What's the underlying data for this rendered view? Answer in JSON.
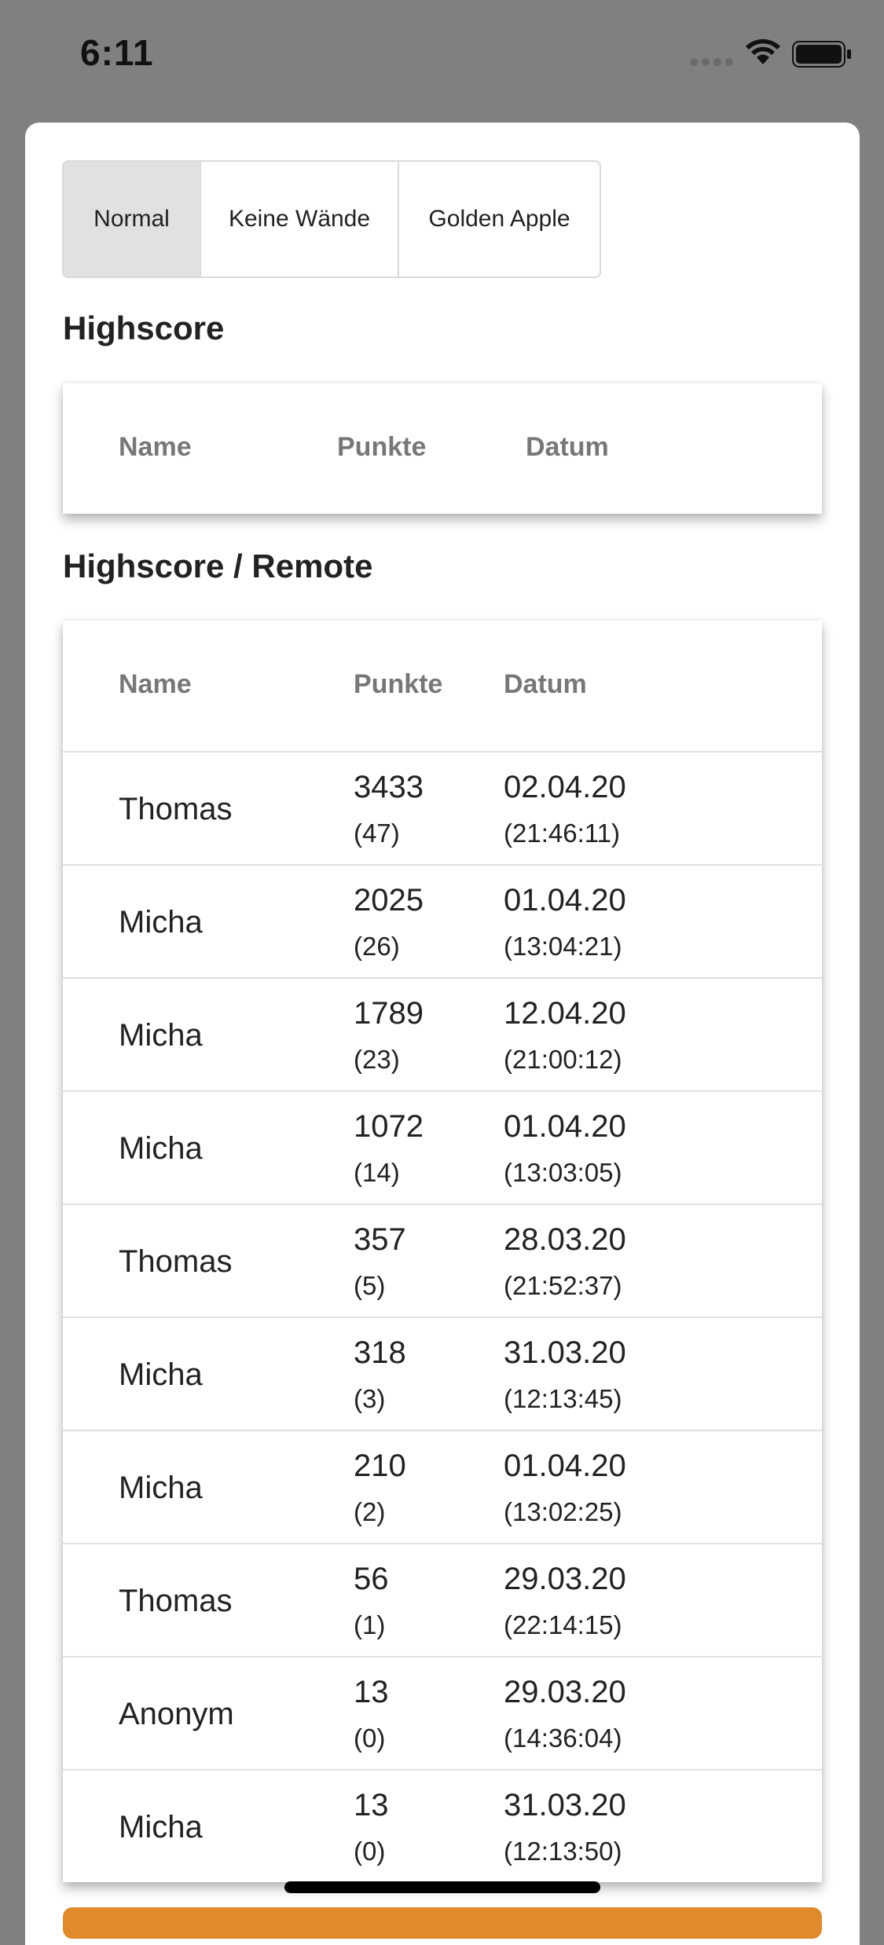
{
  "status_bar": {
    "time": "6:11"
  },
  "tabs": [
    {
      "label": "Normal",
      "active": true
    },
    {
      "label": "Keine Wände",
      "active": false
    },
    {
      "label": "Golden Apple",
      "active": false
    }
  ],
  "local_section": {
    "title": "Highscore",
    "columns": [
      "Name",
      "Punkte",
      "Datum"
    ]
  },
  "remote_section": {
    "title": "Highscore / Remote",
    "columns": [
      "Name",
      "Punkte",
      "Datum"
    ],
    "rows": [
      {
        "name": "Thomas",
        "points": "3433",
        "count": "(47)",
        "date": "02.04.20",
        "time": "(21:46:11)"
      },
      {
        "name": "Micha",
        "points": "2025",
        "count": "(26)",
        "date": "01.04.20",
        "time": "(13:04:21)"
      },
      {
        "name": "Micha",
        "points": "1789",
        "count": "(23)",
        "date": "12.04.20",
        "time": "(21:00:12)"
      },
      {
        "name": "Micha",
        "points": "1072",
        "count": "(14)",
        "date": "01.04.20",
        "time": "(13:03:05)"
      },
      {
        "name": "Thomas",
        "points": "357",
        "count": "(5)",
        "date": "28.03.20",
        "time": "(21:52:37)"
      },
      {
        "name": "Micha",
        "points": "318",
        "count": "(3)",
        "date": "31.03.20",
        "time": "(12:13:45)"
      },
      {
        "name": "Micha",
        "points": "210",
        "count": "(2)",
        "date": "01.04.20",
        "time": "(13:02:25)"
      },
      {
        "name": "Thomas",
        "points": "56",
        "count": "(1)",
        "date": "29.03.20",
        "time": "(22:14:15)"
      },
      {
        "name": "Anonym",
        "points": "13",
        "count": "(0)",
        "date": "29.03.20",
        "time": "(14:36:04)"
      },
      {
        "name": "Micha",
        "points": "13",
        "count": "(0)",
        "date": "31.03.20",
        "time": "(12:13:50)"
      }
    ]
  },
  "colors": {
    "backdrop": "#808080",
    "active_tab": "#e1e1e1",
    "header_text": "#777777",
    "accent_button": "#e08a2e"
  }
}
